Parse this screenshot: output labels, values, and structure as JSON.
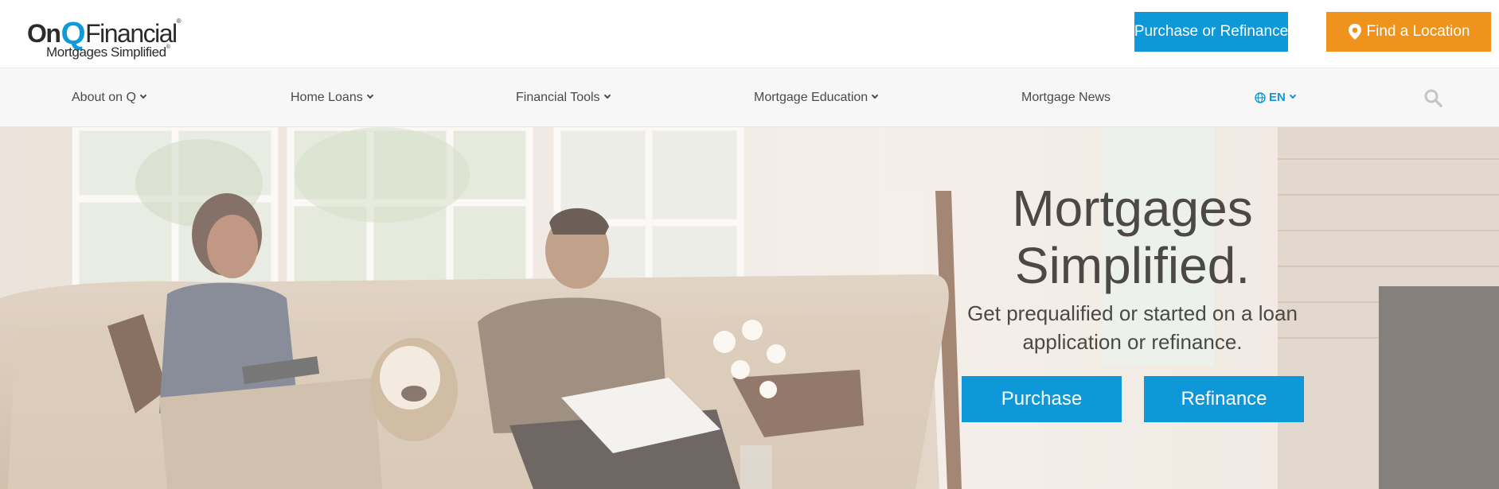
{
  "brand": {
    "name_part1": "On",
    "name_q": "Q",
    "name_part2": "Financial",
    "tagline": "Mortgages Simplified",
    "reg_mark": "®"
  },
  "header": {
    "purchase_refinance_label": "Purchase or Refinance",
    "find_location_label": "Find a Location"
  },
  "nav": {
    "items": [
      {
        "label": "About on Q",
        "has_dropdown": true
      },
      {
        "label": "Home Loans",
        "has_dropdown": true
      },
      {
        "label": "Financial Tools",
        "has_dropdown": true
      },
      {
        "label": "Mortgage Education",
        "has_dropdown": true
      },
      {
        "label": "Mortgage News",
        "has_dropdown": false
      }
    ],
    "language": "EN"
  },
  "hero": {
    "title_line1": "Mortgages",
    "title_line2": "Simplified.",
    "subtitle_line1": "Get prequalified or started on a loan",
    "subtitle_line2": "application or refinance.",
    "purchase_label": "Purchase",
    "refinance_label": "Refinance"
  },
  "icons": {
    "location": "map-pin-icon",
    "language": "globe-icon",
    "search": "search-icon",
    "dropdown": "chevron-down-icon"
  },
  "colors": {
    "accent_blue": "#0e98d8",
    "accent_orange": "#f0931d",
    "brand_q": "#0f9ad9",
    "nav_background": "#f8f7f7",
    "text_dark": "#4b4845"
  }
}
